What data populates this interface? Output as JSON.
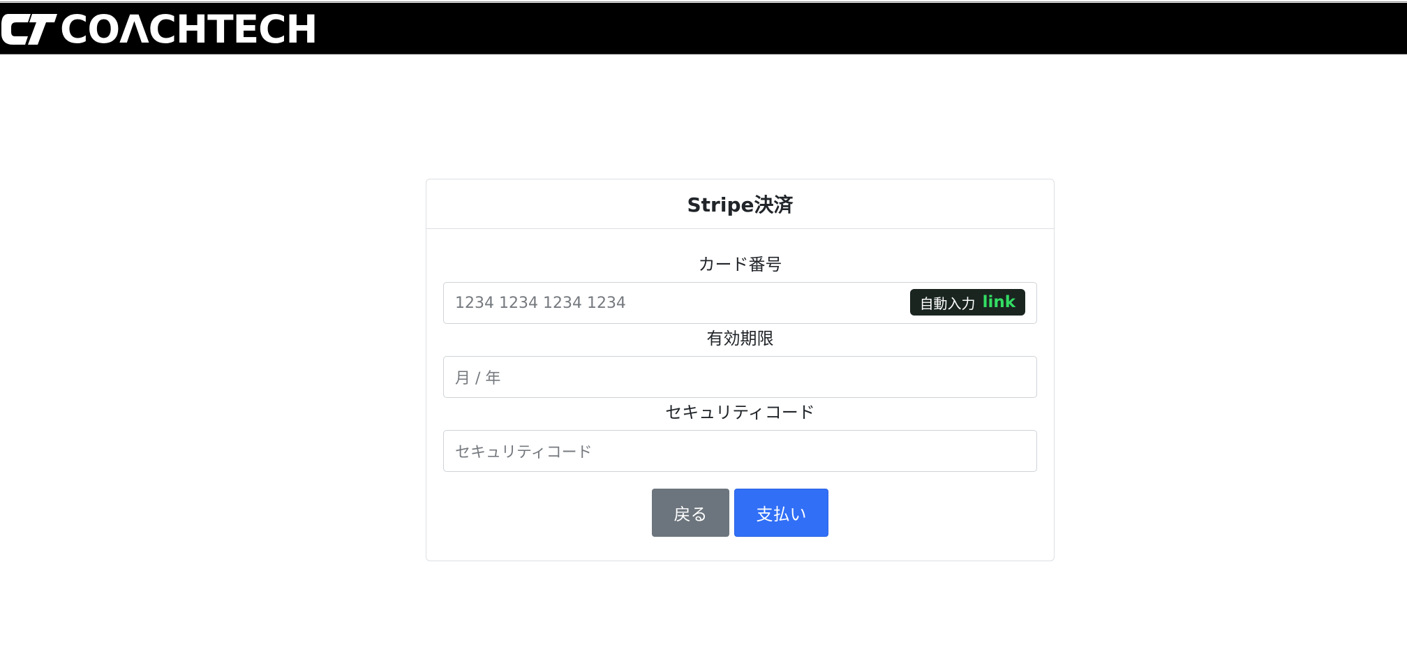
{
  "header": {
    "logo_text": "COΛCHTECH",
    "logo_mark": "CT"
  },
  "card": {
    "title": "Stripe決済",
    "card_number": {
      "label": "カード番号",
      "placeholder": "1234 1234 1234 1234",
      "autofill_label": "自動入力",
      "autofill_brand": "link"
    },
    "expiry": {
      "label": "有効期限",
      "placeholder": "月 / 年"
    },
    "cvc": {
      "label": "セキュリティコード",
      "placeholder": "セキュリティコード"
    },
    "buttons": {
      "back": "戻る",
      "pay": "支払い"
    }
  },
  "colors": {
    "header_bg": "#000000",
    "back_button": "#6c757d",
    "pay_button": "#316ff6",
    "link_green": "#33dd63"
  }
}
